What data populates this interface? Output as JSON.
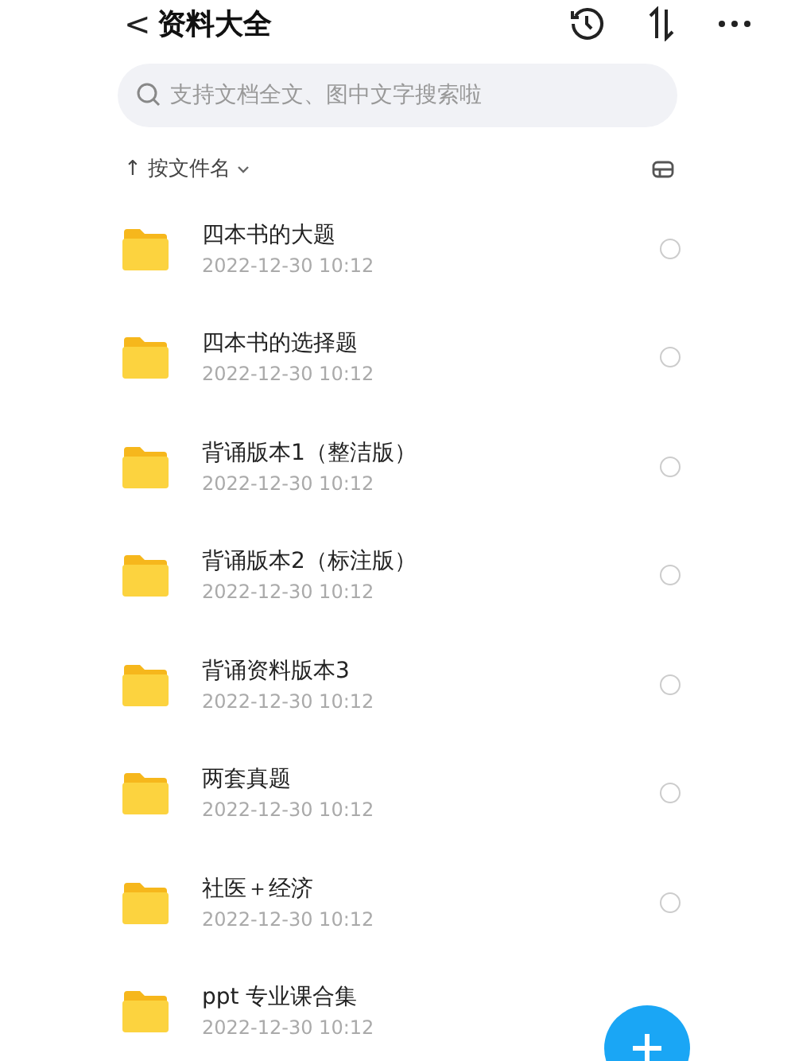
{
  "header": {
    "back": "<",
    "title": "资料大全"
  },
  "search": {
    "placeholder": "支持文档全文、图中文字搜索啦"
  },
  "sort": {
    "arrow": "↑",
    "label": "按文件名"
  },
  "files": [
    {
      "name": "四本书的大题",
      "date": "2022-12-30 10:12",
      "selected": false
    },
    {
      "name": "四本书的选择题",
      "date": "2022-12-30 10:12",
      "selected": false
    },
    {
      "name": "背诵版本1（整洁版）",
      "date": "2022-12-30 10:12",
      "selected": false
    },
    {
      "name": "背诵版本2（标注版）",
      "date": "2022-12-30 10:12",
      "selected": false
    },
    {
      "name": "背诵资料版本3",
      "date": "2022-12-30 10:12",
      "selected": false
    },
    {
      "name": "两套真题",
      "date": "2022-12-30 10:12",
      "selected": false
    },
    {
      "name": "社医＋经济",
      "date": "2022-12-30 10:12",
      "selected": false
    },
    {
      "name": "ppt 专业课合集",
      "date": "2022-12-30 10:12"
    }
  ]
}
